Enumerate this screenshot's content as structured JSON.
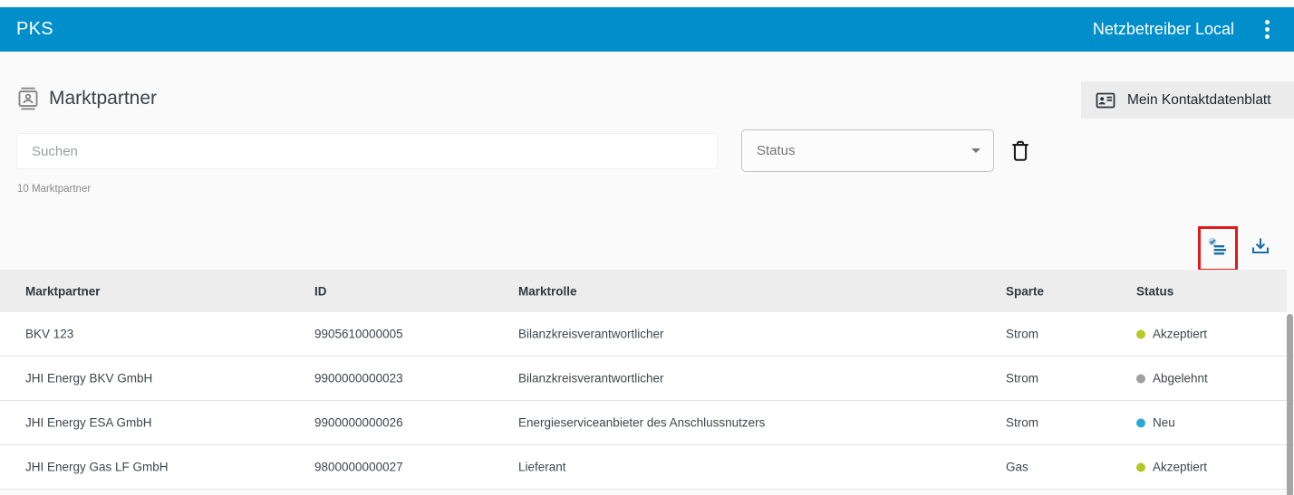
{
  "header": {
    "app_title": "PKS",
    "account_label": "Netzbetreiber Local"
  },
  "page": {
    "title": "Marktpartner",
    "contact_button_label": "Mein Kontaktdatenblatt",
    "search_placeholder": "Suchen",
    "status_filter_label": "Status",
    "count_text": "10 Marktpartner"
  },
  "icons": {
    "app_menu": "kebab-menu",
    "page_title": "contacts-card",
    "contact_button": "contact-card",
    "clear_filter": "trash",
    "column_filter": "list-check",
    "export": "download"
  },
  "annotation": {
    "type": "highlight-box",
    "color": "#e01a1a"
  },
  "colors": {
    "appbar": "#008fcb",
    "action_icon_blue": "#1a6fa5",
    "status_akzeptiert": "#b5c827",
    "status_abgelehnt": "#9e9e9e",
    "status_neu": "#29a9d8"
  },
  "table": {
    "columns": [
      "Marktpartner",
      "ID",
      "Marktrolle",
      "Sparte",
      "Status"
    ],
    "rows": [
      {
        "name": "BKV 123",
        "id": "9905610000005",
        "role": "Bilanzkreisverantwortlicher",
        "sparte": "Strom",
        "status": {
          "label": "Akzeptiert",
          "color": "#b5c827"
        }
      },
      {
        "name": "JHI Energy BKV GmbH",
        "id": "9900000000023",
        "role": "Bilanzkreisverantwortlicher",
        "sparte": "Strom",
        "status": {
          "label": "Abgelehnt",
          "color": "#9e9e9e"
        }
      },
      {
        "name": "JHI Energy ESA GmbH",
        "id": "9900000000026",
        "role": "Energieserviceanbieter des Anschlussnutzers",
        "sparte": "Strom",
        "status": {
          "label": "Neu",
          "color": "#29a9d8"
        }
      },
      {
        "name": "JHI Energy Gas LF GmbH",
        "id": "9800000000027",
        "role": "Lieferant",
        "sparte": "Gas",
        "status": {
          "label": "Akzeptiert",
          "color": "#b5c827"
        }
      }
    ]
  }
}
